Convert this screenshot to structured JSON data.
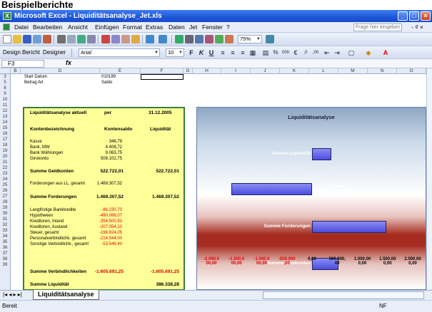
{
  "heading": "Beispielberichte",
  "window": {
    "title": "Microsoft Excel - Liquiditätsanalyse_Jet.xls",
    "app_icon": "X"
  },
  "menu": {
    "items": [
      "Datei",
      "Bearbeiten",
      "Ansicht",
      "Einfügen",
      "Format",
      "Extras",
      "Daten",
      "Jet",
      "Fenster",
      "?"
    ],
    "help_placeholder": "Frage hier eingeben"
  },
  "toolbar1": {
    "zoom": "75%"
  },
  "toolbar2": {
    "design": "Design",
    "bericht": "Bericht",
    "designer": "Designer",
    "font": "Arial",
    "size": "10"
  },
  "formula_bar": {
    "cell_ref": "F3",
    "fx": "fx"
  },
  "columns": [
    "B",
    "D",
    "E",
    "F",
    "G",
    "H",
    "I",
    "J",
    "K",
    "L",
    "M",
    "N",
    "O"
  ],
  "rows": [
    "3",
    "5",
    "8",
    "9",
    "10",
    "11",
    "12",
    "13",
    "14",
    "15",
    "16",
    "17",
    "18",
    "19",
    "20",
    "21",
    "22",
    "23",
    "24",
    "25",
    "26",
    "27",
    "28",
    "29",
    "30",
    "31",
    "32",
    "33",
    "34",
    "35",
    "36",
    "37",
    "38",
    "39"
  ],
  "top_cells": {
    "start_label": "Start Datum",
    "start_value": "010199",
    "betrag_label": "Betrag Art",
    "betrag_value": "Saldo"
  },
  "table": {
    "header": {
      "title": "Liquiditätsanalyse aktuell",
      "per": "per",
      "date": "31.12.2005"
    },
    "col_headers": {
      "k": "Kontenbezeichnung",
      "s": "Kontensaldo",
      "l": "Liquidität"
    },
    "group1": [
      {
        "name": "Kasse",
        "saldo": "346,79"
      },
      {
        "name": "Bank, MW",
        "saldo": "4.408,72"
      },
      {
        "name": "Bank Währungen",
        "saldo": "9.063,75"
      },
      {
        "name": "Girokonto",
        "saldo": "508.102,75"
      }
    ],
    "sum1": {
      "label": "Summe Geldkonten",
      "saldo": "522.722,01",
      "liq": "522.722,01"
    },
    "forderungen_row": {
      "name": "Forderungen aus LL, gesamt",
      "saldo": "1.469.307,52"
    },
    "sum2": {
      "label": "Summe Forderungen",
      "saldo": "1.469.307,52",
      "liq": "1.469.307,52"
    },
    "group3": [
      {
        "name": "Langfristige Bankkredite",
        "saldo": "-86.230,70"
      },
      {
        "name": "Hypotheken",
        "saldo": "-490.086,07"
      },
      {
        "name": "Kreditoren, Inland",
        "saldo": "-354.500,93"
      },
      {
        "name": "Kreditoren, Ausland",
        "saldo": "-207.054,10"
      },
      {
        "name": "Steuer, gesamt",
        "saldo": "-198.924,05"
      },
      {
        "name": "Personalverbindlichk. gesamt",
        "saldo": "-214.544,00"
      },
      {
        "name": "Sonstige Verbindlichk., gesamt",
        "saldo": "-53.546,40"
      }
    ],
    "sum3": {
      "label": "Summe Verbindlichkeiten",
      "saldo": "-1.605.691,25",
      "liq": "-1.605.691,25"
    },
    "sum4": {
      "label": "Summe Liquidität",
      "liq": "386.338,28"
    }
  },
  "chart_data": {
    "type": "bar",
    "title": "Liquiditätsanalyse",
    "categories": [
      "Summe Liquidität",
      "Summe Verbindlichkeiten",
      "Summe Forderungen",
      "Summe Geldkonten"
    ],
    "values": [
      386338.28,
      -1605691.25,
      1469307.52,
      522722.01
    ],
    "xlim": [
      -2000000,
      2000000
    ],
    "ticks": [
      [
        "-2.000.0",
        "00,00"
      ],
      [
        "-1.500.0",
        "00,00"
      ],
      [
        "-1.000.0",
        "00,00"
      ],
      [
        "-500.000",
        ",00"
      ],
      [
        "0,00",
        ""
      ],
      [
        "500.000,",
        "00"
      ],
      [
        "1.000.00",
        "0,00"
      ],
      [
        "1.500.00",
        "0,00"
      ],
      [
        "2.000.00",
        "0,00"
      ]
    ],
    "orientation": "horizontal",
    "bar_color": "#6b6df0"
  },
  "sheet_tab": "Liquiditätsanalyse",
  "status": {
    "left": "Bereit",
    "right": "NF"
  }
}
